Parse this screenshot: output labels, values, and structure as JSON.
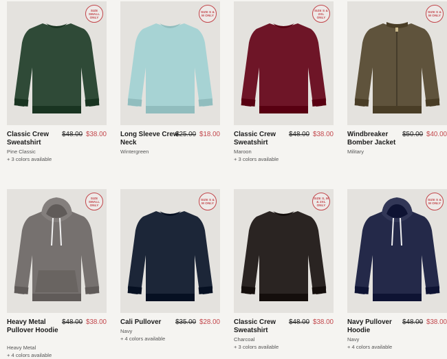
{
  "products": [
    {
      "name": "Classic Crew Sweatshirt",
      "old_price": "$48.00",
      "price": "$38.00",
      "color_name": "Pine Classic",
      "more_colors": "+ 3 colors available",
      "badge": "SIZE SMALL ONLY",
      "color": "#2f4a37",
      "type": "crew"
    },
    {
      "name": "Long Sleeve Crew Neck",
      "old_price": "$25.00",
      "price": "$18.00",
      "color_name": "Wintergreen",
      "more_colors": "",
      "badge": "SIZE S & M ONLY",
      "color": "#a7d3d4",
      "type": "longsleeve"
    },
    {
      "name": "Classic Crew Sweatshirt",
      "old_price": "$48.00",
      "price": "$38.00",
      "color_name": "Maroon",
      "more_colors": "+ 3 colors available",
      "badge": "SIZE S & 2XL ONLY",
      "color": "#6e1527",
      "type": "crew"
    },
    {
      "name": "Windbreaker Bomber Jacket",
      "old_price": "$50.00",
      "price": "$40.00",
      "color_name": "Military",
      "more_colors": "",
      "badge": "SIZE S & M ONLY",
      "color": "#5f533c",
      "type": "bomber"
    },
    {
      "name": "Heavy Metal Pullover Hoodie",
      "old_price": "$48.00",
      "price": "$38.00",
      "color_name": "Heavy Metal",
      "more_colors": "+ 4 colors available",
      "badge": "SIZE SMALL ONLY",
      "color": "#76716f",
      "type": "hoodie"
    },
    {
      "name": "Cali Pullover",
      "old_price": "$35.00",
      "price": "$28.00",
      "color_name": "Navy",
      "more_colors": "+ 4 colors available",
      "badge": "SIZE S & M ONLY",
      "color": "#1c2638",
      "type": "crew"
    },
    {
      "name": "Classic Crew Sweatshirt",
      "old_price": "$48.00",
      "price": "$38.00",
      "color_name": "Charcoal",
      "more_colors": "+ 3 colors available",
      "badge": "SIZE S, M & 2XL ONLY",
      "color": "#2a2422",
      "type": "crew"
    },
    {
      "name": "Navy Pullover Hoodie",
      "old_price": "$48.00",
      "price": "$38.00",
      "color_name": "Navy",
      "more_colors": "+ 4 colors available",
      "badge": "SIZE S & M ONLY",
      "color": "#242949",
      "type": "hoodie"
    }
  ]
}
